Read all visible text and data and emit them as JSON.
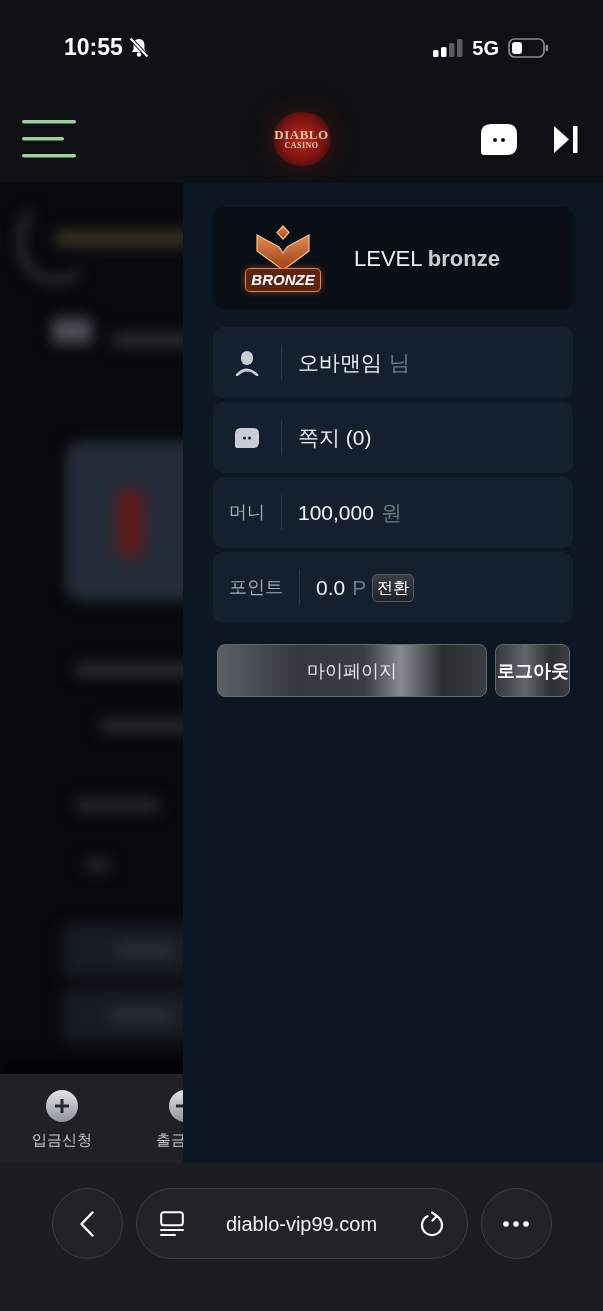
{
  "status_bar": {
    "time": "10:55",
    "network": "5G"
  },
  "header": {
    "logo": {
      "title": "DIABLO",
      "subtitle": "CASINO"
    }
  },
  "background_page": {
    "bottom_nav": [
      {
        "kind": "plus",
        "label": "입금신청"
      },
      {
        "kind": "minus",
        "label": "출금"
      }
    ]
  },
  "side_panel": {
    "level": {
      "badge": "BRONZE",
      "text": "LEVEL **bronze**"
    },
    "rows": [
      {
        "kind": "user",
        "value": "오바맨임",
        "unit": "님"
      },
      {
        "kind": "message",
        "value": "쪽지 (0)"
      },
      {
        "kind": "label",
        "label": "머니",
        "value": "100,000",
        "unit": "원"
      },
      {
        "kind": "label",
        "label": "포인트",
        "value": "0.0",
        "unit": "P",
        "action": "전환"
      }
    ],
    "buttons": [
      {
        "kind": "wide",
        "label": "마이페이지"
      },
      {
        "kind": "bold",
        "label": "로그아웃"
      }
    ]
  },
  "browser_bar": {
    "url": "diablo-vip99.com"
  }
}
